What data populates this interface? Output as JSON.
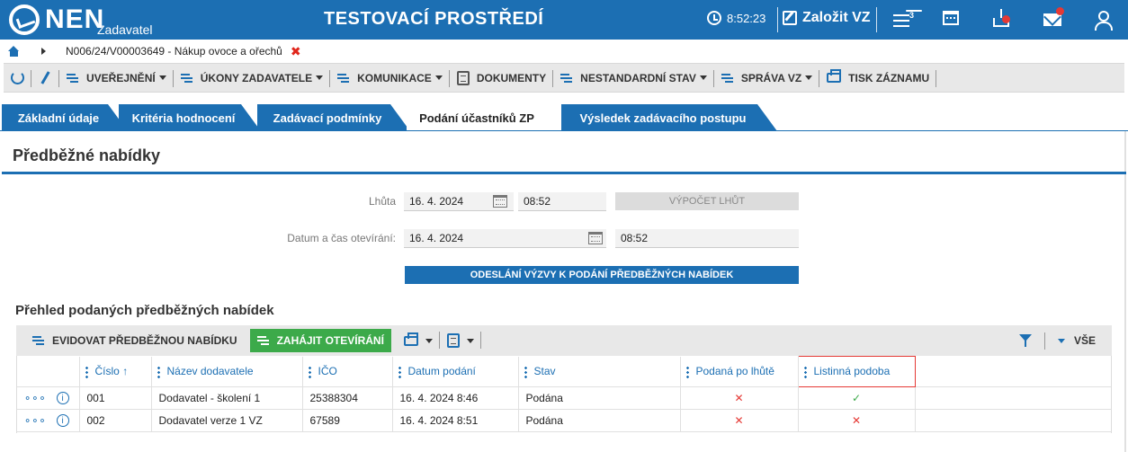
{
  "header": {
    "logo_text": "NEN",
    "logo_sub": "Zadavatel",
    "env_title": "TESTOVACÍ PROSTŘEDÍ",
    "time": "8:52:23",
    "create_label": "Založit VZ",
    "menu_badge": "3",
    "icons": [
      "clock-icon",
      "edit-icon",
      "menu-icon",
      "calendar-icon",
      "inbox-icon",
      "mail-icon",
      "user-icon"
    ],
    "color": "#1c6fb3"
  },
  "breadcrumb": {
    "text": "N006/24/V00003649 - Nákup ovoce a ořechů",
    "close": "✖"
  },
  "toolbar": {
    "items": [
      {
        "label": "UVEŘEJNĚNÍ"
      },
      {
        "label": "ÚKONY ZADAVATELE"
      },
      {
        "label": "KOMUNIKACE"
      },
      {
        "label": "DOKUMENTY"
      },
      {
        "label": "NESTANDARDNÍ STAV"
      },
      {
        "label": "SPRÁVA VZ"
      },
      {
        "label": "TISK ZÁZNAMU"
      }
    ]
  },
  "tabs": [
    {
      "label": "Základní údaje"
    },
    {
      "label": "Kritéria hodnocení"
    },
    {
      "label": "Zadávací podmínky"
    },
    {
      "label": "Podání účastníků ZP",
      "active": true
    },
    {
      "label": "Výsledek zadávacího postupu"
    }
  ],
  "section": {
    "title": "Předběžné nabídky",
    "deadline_label": "Lhůta",
    "deadline_date": "16. 4. 2024",
    "deadline_time": "08:52",
    "calc_button": "VÝPOČET LHŮT",
    "opening_label": "Datum a čas otevírání:",
    "opening_date": "16. 4. 2024",
    "opening_time": "08:52",
    "send_button": "ODESLÁNÍ VÝZVY K PODÁNÍ PŘEDBĚŽNÝCH NABÍDEK"
  },
  "grid": {
    "title": "Přehled podaných předběžných nabídek",
    "record_button": "EVIDOVAT PŘEDBĚŽNOU NABÍDKU",
    "start_button": "ZAHÁJIT OTEVÍRÁNÍ",
    "all_label": "VŠE",
    "sort_indicator": "↑",
    "columns": [
      "Číslo",
      "Název dodavatele",
      "IČO",
      "Datum podání",
      "Stav",
      "Podaná po lhůtě",
      "Listinná podoba"
    ],
    "rows": [
      {
        "cislo": "001",
        "nazev": "Dodavatel - školení 1",
        "ico": "25388304",
        "datum": "16. 4. 2024 8:46",
        "stav": "Podána",
        "po_lhute": "✕",
        "listinna": "✓"
      },
      {
        "cislo": "002",
        "nazev": "Dodavatel verze 1 VZ",
        "ico": "67589",
        "datum": "16. 4. 2024 8:51",
        "stav": "Podána",
        "po_lhute": "✕",
        "listinna": "✕"
      }
    ],
    "colors": {
      "no": "#e53935",
      "yes": "#3caa4a",
      "action": "#3caa4a"
    }
  }
}
